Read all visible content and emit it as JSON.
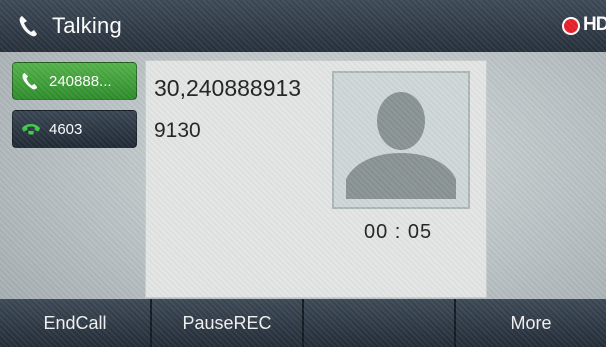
{
  "status_bar": {
    "title": "Talking",
    "hd_label": "HD",
    "recording_color": "#e8202a"
  },
  "calls": [
    {
      "label": "240888...",
      "state": "active",
      "icon": "phone-handset-icon"
    },
    {
      "label": "4603",
      "state": "held",
      "icon": "phone-held-icon"
    }
  ],
  "call_detail": {
    "number": "30,240888913",
    "extension": "9130",
    "duration": "00 : 05",
    "avatar_icon": "contact-avatar-icon"
  },
  "softkeys": [
    {
      "label": "EndCall"
    },
    {
      "label": "PauseREC"
    },
    {
      "label": ""
    },
    {
      "label": "More"
    }
  ],
  "colors": {
    "active_call": "#3fa23a",
    "topbar": "#2e3945",
    "panel": "#e3e6e4"
  }
}
